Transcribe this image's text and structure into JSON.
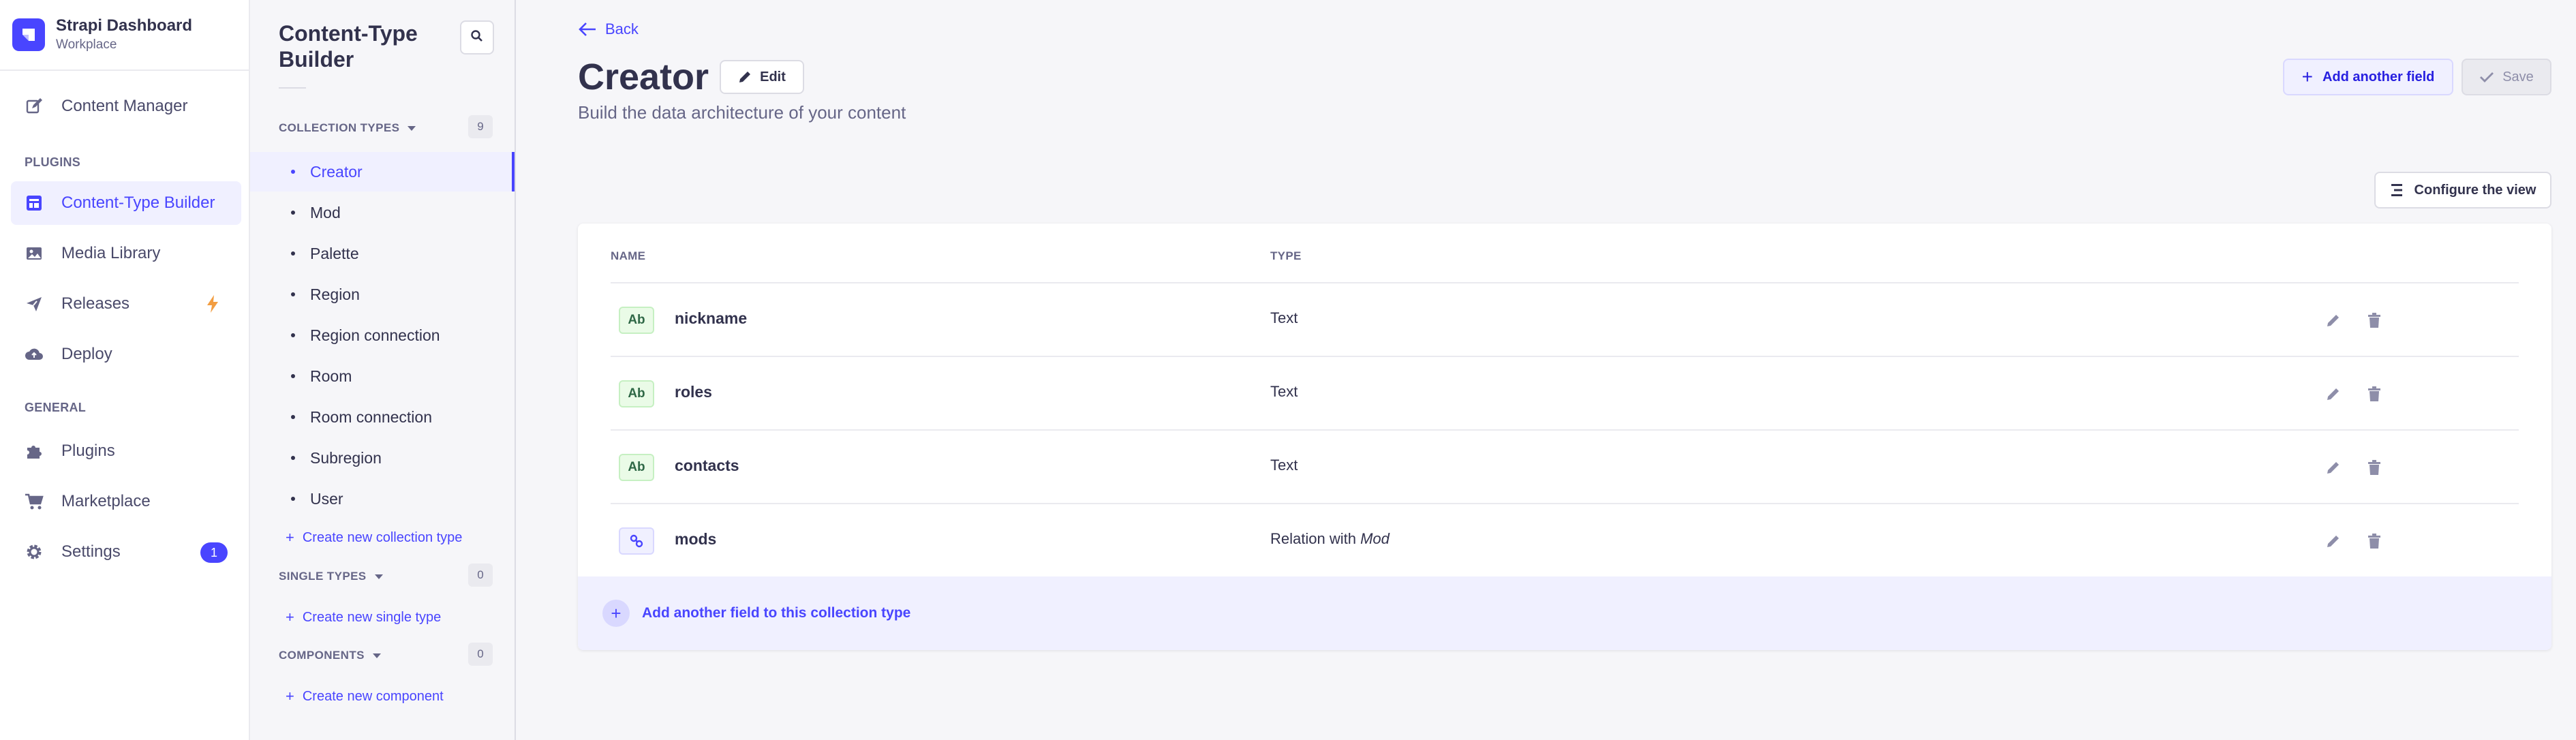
{
  "brand": {
    "title": "Strapi Dashboard",
    "subtitle": "Workplace",
    "accent": "#4945ff"
  },
  "mainnav": {
    "content_manager": "Content Manager",
    "plugins_section": "PLUGINS",
    "content_type_builder": "Content-Type Builder",
    "media_library": "Media Library",
    "releases": "Releases",
    "deploy": "Deploy",
    "general_section": "GENERAL",
    "plugins": "Plugins",
    "marketplace": "Marketplace",
    "settings": "Settings",
    "settings_badge": "1"
  },
  "subnav": {
    "title": "Content-Type Builder",
    "collection_types_label": "COLLECTION TYPES",
    "collection_types_count": "9",
    "collection_types": [
      "Creator",
      "Mod",
      "Palette",
      "Region",
      "Region connection",
      "Room",
      "Room connection",
      "Subregion",
      "User"
    ],
    "create_collection": "Create new collection type",
    "single_types_label": "SINGLE TYPES",
    "single_types_count": "0",
    "create_single": "Create new single type",
    "components_label": "COMPONENTS",
    "components_count": "0",
    "create_component": "Create new component"
  },
  "header": {
    "back": "Back",
    "title": "Creator",
    "edit": "Edit",
    "subtitle": "Build the data architecture of your content",
    "add_field": "Add another field",
    "save": "Save",
    "configure": "Configure the view"
  },
  "table": {
    "col_name": "NAME",
    "col_type": "TYPE",
    "rows": [
      {
        "badge": "Ab",
        "name": "nickname",
        "type": "Text",
        "type_target": ""
      },
      {
        "badge": "Ab",
        "name": "roles",
        "type": "Text",
        "type_target": ""
      },
      {
        "badge": "Ab",
        "name": "contacts",
        "type": "Text",
        "type_target": ""
      },
      {
        "badge": "",
        "name": "mods",
        "type": "Relation with",
        "type_target": "Mod"
      }
    ],
    "add_row": "Add another field to this collection type"
  }
}
